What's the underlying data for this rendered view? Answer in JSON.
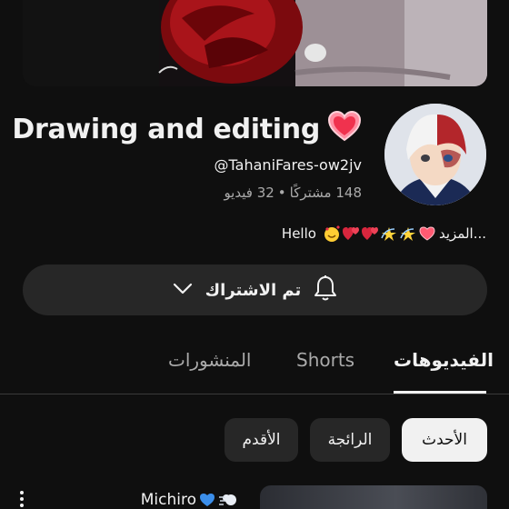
{
  "channel": {
    "name": "Drawing and editing",
    "handle": "@TahaniFares-ow2jv",
    "subscribers": "148 مشتركًا",
    "separator": "•",
    "videos": "32 فيديو",
    "about_more": "المزيد...",
    "about_text": "Hello"
  },
  "subscribe": {
    "label": "تم الاشتراك"
  },
  "tabs": [
    {
      "label": "الفيديوهات",
      "active": true
    },
    {
      "label": "Shorts",
      "active": false
    },
    {
      "label": "المنشورات",
      "active": false
    }
  ],
  "filters": [
    {
      "label": "الأحدث",
      "selected": true
    },
    {
      "label": "الرائجة",
      "selected": false
    },
    {
      "label": "الأقدم",
      "selected": false
    }
  ],
  "video": {
    "title": "Michiro"
  },
  "icons": {
    "title": "heart-icon",
    "subscribe_bell": "bell-icon",
    "subscribe_chevron": "chevron-down-icon",
    "video_menu": "more-vert-icon"
  }
}
